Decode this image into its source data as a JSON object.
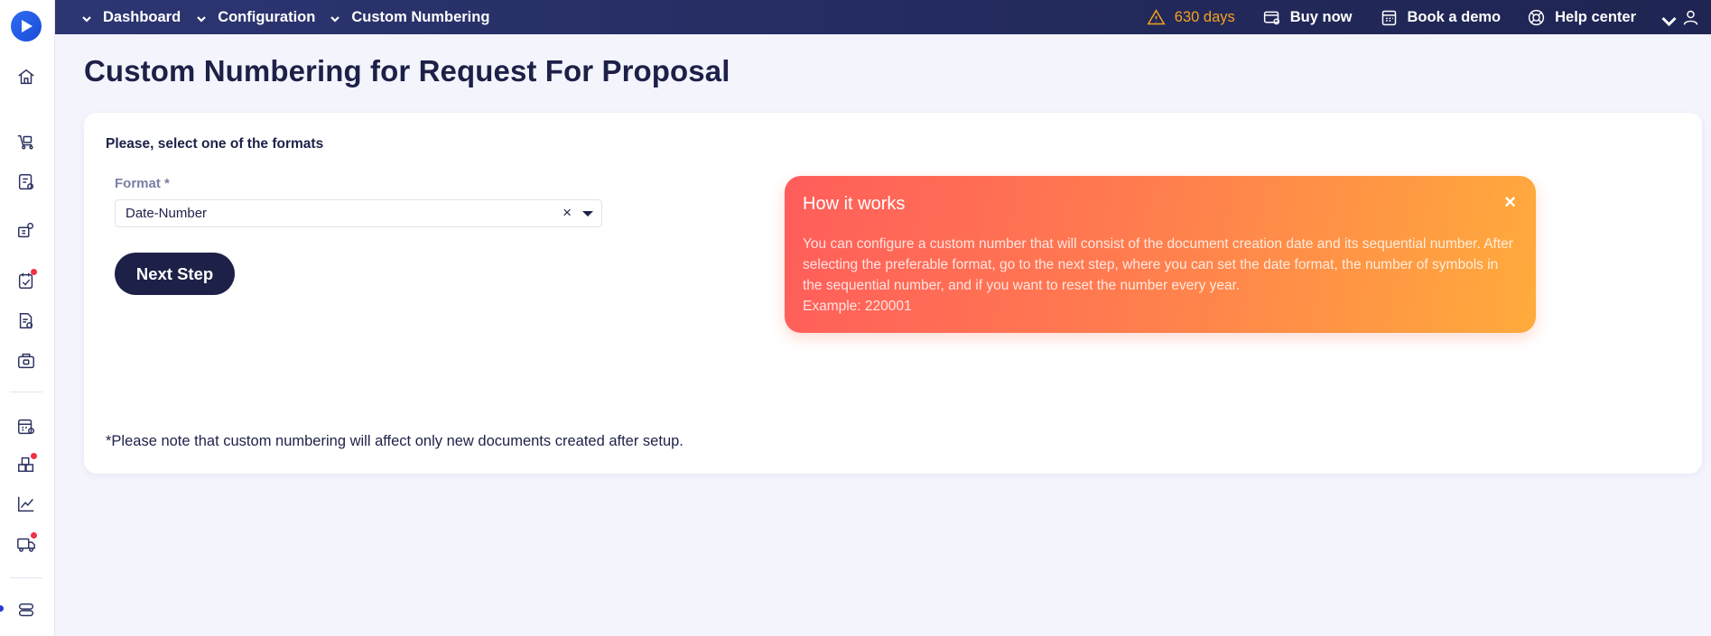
{
  "topbar": {
    "breadcrumbs": [
      "Dashboard",
      "Configuration",
      "Custom Numbering"
    ],
    "trial_days": "630 days",
    "buy_now": "Buy now",
    "book_demo": "Book a demo",
    "help_center": "Help center"
  },
  "page": {
    "title": "Custom Numbering for Request For Proposal"
  },
  "form": {
    "subtitle": "Please, select one of the formats",
    "format_label": "Format *",
    "format_value": "Date-Number",
    "clear_symbol": "×",
    "next_button": "Next Step",
    "note": "*Please note that custom numbering will affect only new documents created after setup."
  },
  "info": {
    "title": "How it works",
    "close_symbol": "×",
    "text": "You can configure a custom number that will consist of the document creation date and its sequential number. After selecting the preferable format, go to the next step, where you can set the date format, the number of symbols in the sequential number, and if you want to reset the number every year.",
    "example": "Example: 220001"
  },
  "sidebar": {
    "icons": [
      "home-icon",
      "cart-icon",
      "catalog-icon",
      "suppliers-icon",
      "approvals-icon",
      "documents-icon",
      "budget-icon",
      "invoices-icon",
      "inventory-icon",
      "analytics-icon",
      "delivery-icon",
      "settings-icon"
    ]
  },
  "colors": {
    "topbar": "#232a5c",
    "accent_warning": "#f6a21e",
    "primary_button": "#1d2148",
    "info_gradient_start": "#ff5d5b",
    "info_gradient_end": "#ffab3c",
    "notification_dot": "#f0324a"
  }
}
